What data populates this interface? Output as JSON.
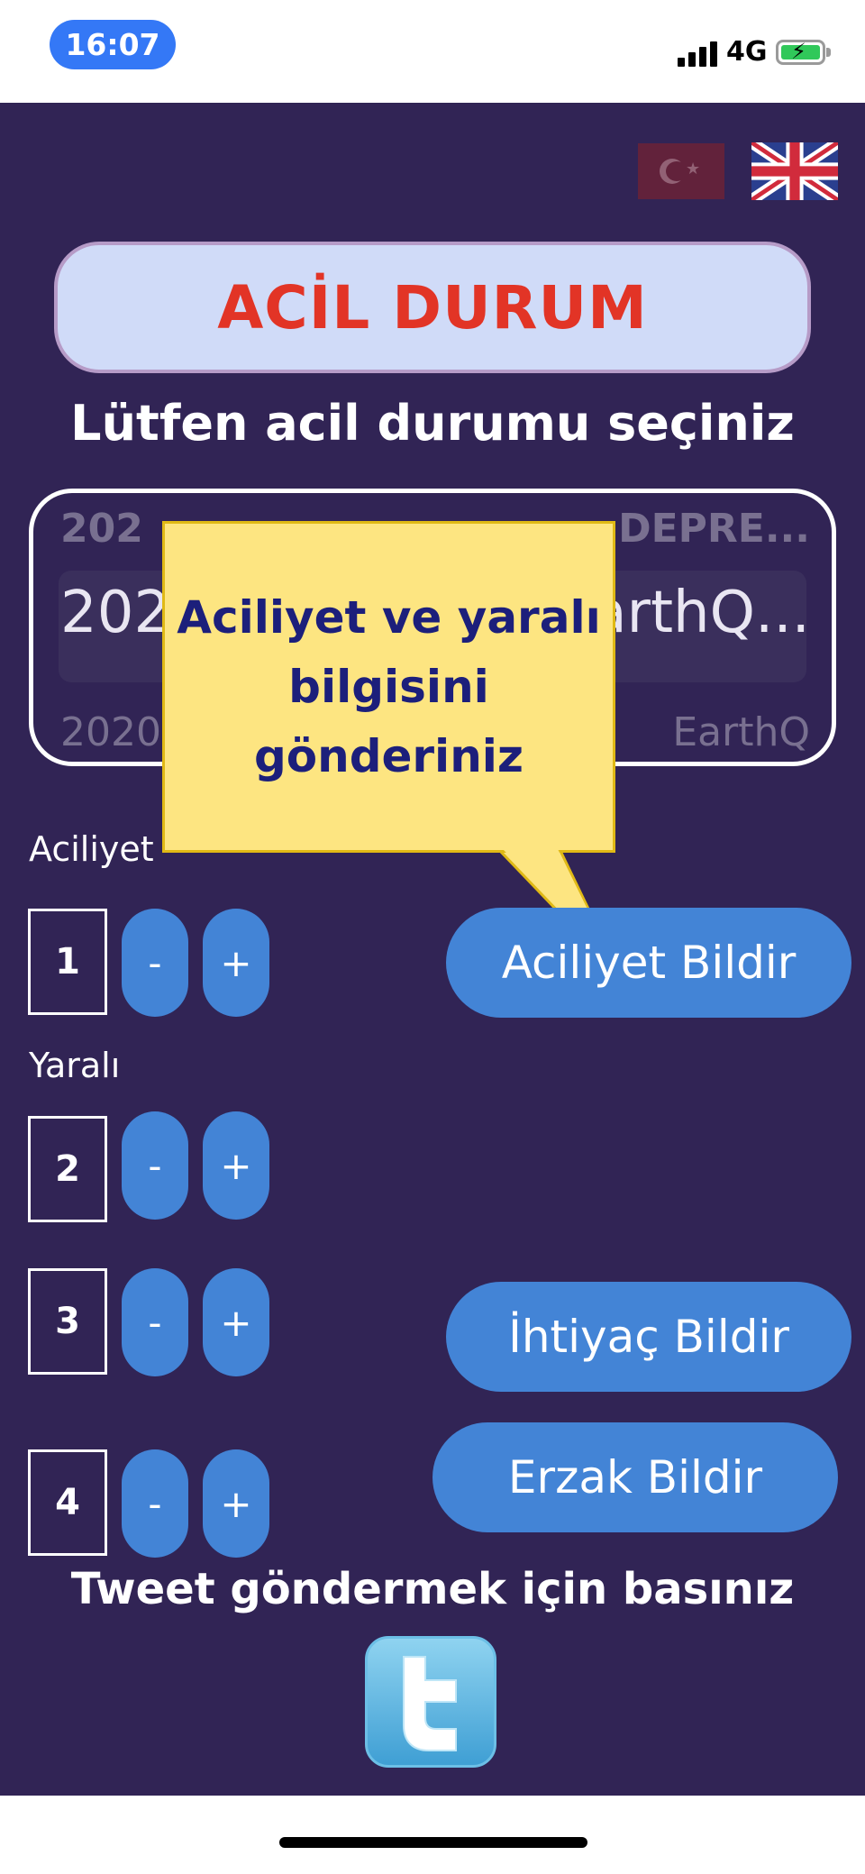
{
  "status_bar": {
    "time": "16:07",
    "network": "4G"
  },
  "title": "ACİL DURUM",
  "subtitle": "Lütfen acil durumu seçiniz",
  "picker": {
    "row_top_left": "202",
    "row_top_right": "DEPRE...",
    "selected_left": "2020",
    "selected_right": "EarthQ...",
    "row_bottom_left": "2020",
    "row_bottom_right": "EarthQ"
  },
  "callout": {
    "line1": "Aciliyet ve yaralı",
    "line2": "bilgisini",
    "line3": "gönderiniz"
  },
  "urgency": {
    "label": "Aciliyet",
    "value": "1",
    "minus": "-",
    "plus": "+",
    "report_button": "Aciliyet Bildir"
  },
  "injured": {
    "label": "Yaralı",
    "value": "2",
    "minus": "-",
    "plus": "+"
  },
  "need": {
    "value": "3",
    "minus": "-",
    "plus": "+",
    "report_button": "İhtiyaç Bildir"
  },
  "supply": {
    "value": "4",
    "minus": "-",
    "plus": "+",
    "report_button": "Erzak Bildir"
  },
  "tweet_prompt": "Tweet göndermek için basınız",
  "icons": [
    "turkish-flag-icon",
    "uk-flag-icon",
    "twitter-icon",
    "signal-icon",
    "battery-charging-icon"
  ],
  "colors": {
    "background": "#312455",
    "accent": "#4384d6",
    "title_red": "#e23426",
    "callout_bg": "#fde581",
    "callout_text": "#1c1f7b"
  }
}
